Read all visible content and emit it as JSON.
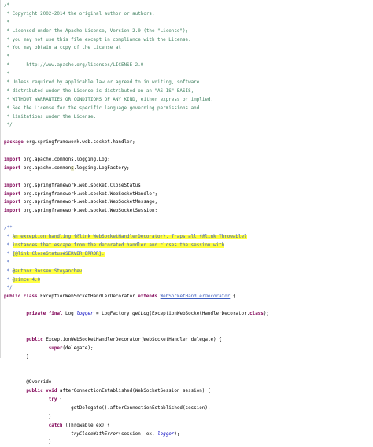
{
  "editor": {
    "lines": [
      [
        {
          "t": "/*",
          "c": "comment"
        }
      ],
      [
        {
          "t": " * Copyright 2002-2014 the original author or authors.",
          "c": "comment"
        }
      ],
      [
        {
          "t": " *",
          "c": "comment"
        }
      ],
      [
        {
          "t": " * Licensed under the Apache License, Version 2.0 (the \"License\");",
          "c": "comment"
        }
      ],
      [
        {
          "t": " * you may not use this file except in compliance with the License.",
          "c": "comment"
        }
      ],
      [
        {
          "t": " * You may obtain a copy of the License at",
          "c": "comment"
        }
      ],
      [
        {
          "t": " *",
          "c": "comment"
        }
      ],
      [
        {
          "t": " *      http://www.apache.org/licenses/LICENSE-2.0",
          "c": "comment"
        }
      ],
      [
        {
          "t": " *",
          "c": "comment"
        }
      ],
      [
        {
          "t": " * Unless required by applicable law or agreed to in writing, software",
          "c": "comment"
        }
      ],
      [
        {
          "t": " * distributed under the License is distributed on an \"AS IS\" BASIS,",
          "c": "comment"
        }
      ],
      [
        {
          "t": " * WITHOUT WARRANTIES OR CONDITIONS OF ANY KIND, either express or implied.",
          "c": "comment"
        }
      ],
      [
        {
          "t": " * See the License for the specific language governing permissions and",
          "c": "comment"
        }
      ],
      [
        {
          "t": " * limitations under the License.",
          "c": "comment"
        }
      ],
      [
        {
          "t": " */",
          "c": "comment"
        }
      ],
      [],
      [
        {
          "t": "package",
          "c": "keyword"
        },
        {
          "t": " org.springframework.web.socket.handler;",
          "c": "plain"
        }
      ],
      [],
      [
        {
          "t": "import",
          "c": "keyword"
        },
        {
          "t": " org.apache.commons.logging.Log;",
          "c": "plain"
        }
      ],
      [
        {
          "t": "import",
          "c": "keyword"
        },
        {
          "t": " org.apache.common",
          "c": "plain"
        },
        {
          "t": "s",
          "c": "plain-hl"
        },
        {
          "t": ".logging.LogFactory;",
          "c": "plain"
        }
      ],
      [],
      [
        {
          "t": "import",
          "c": "keyword"
        },
        {
          "t": " org.springframework.web.socket.CloseStatus;",
          "c": "plain"
        }
      ],
      [
        {
          "t": "import",
          "c": "keyword"
        },
        {
          "t": " org.springframework.web.socket.WebSocketHandler;",
          "c": "plain"
        }
      ],
      [
        {
          "t": "import",
          "c": "keyword"
        },
        {
          "t": " org.springframework.web.socket.WebSocketMessage;",
          "c": "plain"
        }
      ],
      [
        {
          "t": "import",
          "c": "keyword"
        },
        {
          "t": " org.springframework.web.socket.WebSocketSession;",
          "c": "plain"
        }
      ],
      [],
      [
        {
          "t": "/**",
          "c": "doc"
        }
      ],
      [
        {
          "t": " * ",
          "c": "doc"
        },
        {
          "t": "An exception handling {@link WebSocketHandlerDecorator}. Traps all {@link Throwable}",
          "c": "doc-hl"
        }
      ],
      [
        {
          "t": " * ",
          "c": "doc"
        },
        {
          "t": "instances that escape from the decorated handler and closes the session with",
          "c": "doc-hl"
        }
      ],
      [
        {
          "t": " * ",
          "c": "doc"
        },
        {
          "t": "{@link CloseStatus#SERVER_ERROR}.",
          "c": "doc-hl"
        }
      ],
      [
        {
          "t": " *",
          "c": "doc"
        }
      ],
      [
        {
          "t": " * ",
          "c": "doc"
        },
        {
          "t": "@author Rossen Stoyanchev",
          "c": "doc-hl"
        }
      ],
      [
        {
          "t": " * ",
          "c": "doc"
        },
        {
          "t": "@since 4.0",
          "c": "doc-hl"
        }
      ],
      [
        {
          "t": " */",
          "c": "doc"
        }
      ],
      [
        {
          "t": "public class",
          "c": "keyword"
        },
        {
          "t": " ExceptionWebSocketHandlerDecorator ",
          "c": "plain"
        },
        {
          "t": "extends",
          "c": "keyword"
        },
        {
          "t": " ",
          "c": "plain"
        },
        {
          "t": "WebSocketHandlerDecorator",
          "c": "link"
        },
        {
          "t": " {",
          "c": "plain"
        }
      ],
      [],
      [
        {
          "t": "        ",
          "c": "plain"
        },
        {
          "t": "private final",
          "c": "keyword"
        },
        {
          "t": " Log ",
          "c": "plain"
        },
        {
          "t": "logger",
          "c": "field"
        },
        {
          "t": " = LogFactory.",
          "c": "plain"
        },
        {
          "t": "getLog",
          "c": "italic"
        },
        {
          "t": "(ExceptionWebSocketHandlerDecorator.",
          "c": "plain"
        },
        {
          "t": "class",
          "c": "keyword"
        },
        {
          "t": ");",
          "c": "plain"
        }
      ],
      [],
      [],
      [
        {
          "t": "        ",
          "c": "plain"
        },
        {
          "t": "public",
          "c": "keyword"
        },
        {
          "t": " ExceptionWebSocketHandlerDecorator(WebSocketHandler delegate) {",
          "c": "plain"
        }
      ],
      [
        {
          "t": "                ",
          "c": "plain"
        },
        {
          "t": "super",
          "c": "keyword"
        },
        {
          "t": "(delegate);",
          "c": "plain"
        }
      ],
      [
        {
          "t": "        }",
          "c": "plain"
        }
      ],
      [],
      [],
      [
        {
          "t": "        @Override",
          "c": "plain"
        }
      ],
      [
        {
          "t": "        ",
          "c": "plain"
        },
        {
          "t": "public void",
          "c": "keyword"
        },
        {
          "t": " afterConnectionEstablished(WebSocketSession session) {",
          "c": "plain"
        }
      ],
      [
        {
          "t": "                ",
          "c": "plain"
        },
        {
          "t": "try",
          "c": "keyword"
        },
        {
          "t": " {",
          "c": "plain"
        }
      ],
      [
        {
          "t": "                        getDelegate().afterConnectionEstablished(session);",
          "c": "plain"
        }
      ],
      [
        {
          "t": "                }",
          "c": "plain"
        }
      ],
      [
        {
          "t": "                ",
          "c": "plain"
        },
        {
          "t": "catch",
          "c": "keyword"
        },
        {
          "t": " (Throwable ex) {",
          "c": "plain"
        }
      ],
      [
        {
          "t": "                        ",
          "c": "plain"
        },
        {
          "t": "tryCloseWithError",
          "c": "italic"
        },
        {
          "t": "(session, ex, ",
          "c": "plain"
        },
        {
          "t": "logger",
          "c": "field"
        },
        {
          "t": ");",
          "c": "plain"
        }
      ],
      [
        {
          "t": "                }",
          "c": "plain"
        }
      ]
    ]
  }
}
